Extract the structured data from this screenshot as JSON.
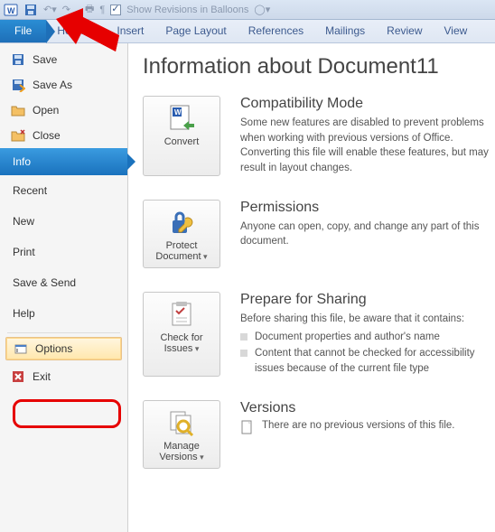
{
  "qat": {
    "show_revisions_label": "Show Revisions in Balloons"
  },
  "tabs": {
    "file": "File",
    "home": "Home",
    "insert": "Insert",
    "page_layout": "Page Layout",
    "references": "References",
    "mailings": "Mailings",
    "review": "Review",
    "view": "View"
  },
  "sidebar": {
    "save": "Save",
    "save_as": "Save As",
    "open": "Open",
    "close": "Close",
    "info": "Info",
    "recent": "Recent",
    "new": "New",
    "print": "Print",
    "save_send": "Save & Send",
    "help": "Help",
    "options": "Options",
    "exit": "Exit"
  },
  "page": {
    "heading": "Information about Document11",
    "sections": {
      "compat": {
        "btn": "Convert",
        "title": "Compatibility Mode",
        "text": "Some new features are disabled to prevent problems when working with previous versions of Office. Converting this file will enable these features, but may result in layout changes."
      },
      "perm": {
        "btn": "Protect Document",
        "title": "Permissions",
        "text": "Anyone can open, copy, and change any part of this document."
      },
      "share": {
        "btn": "Check for Issues",
        "title": "Prepare for Sharing",
        "text": "Before sharing this file, be aware that it contains:",
        "b1": "Document properties and author's name",
        "b2": "Content that cannot be checked for accessibility issues because of the current file type"
      },
      "versions": {
        "btn": "Manage Versions",
        "title": "Versions",
        "text": "There are no previous versions of this file."
      }
    }
  }
}
